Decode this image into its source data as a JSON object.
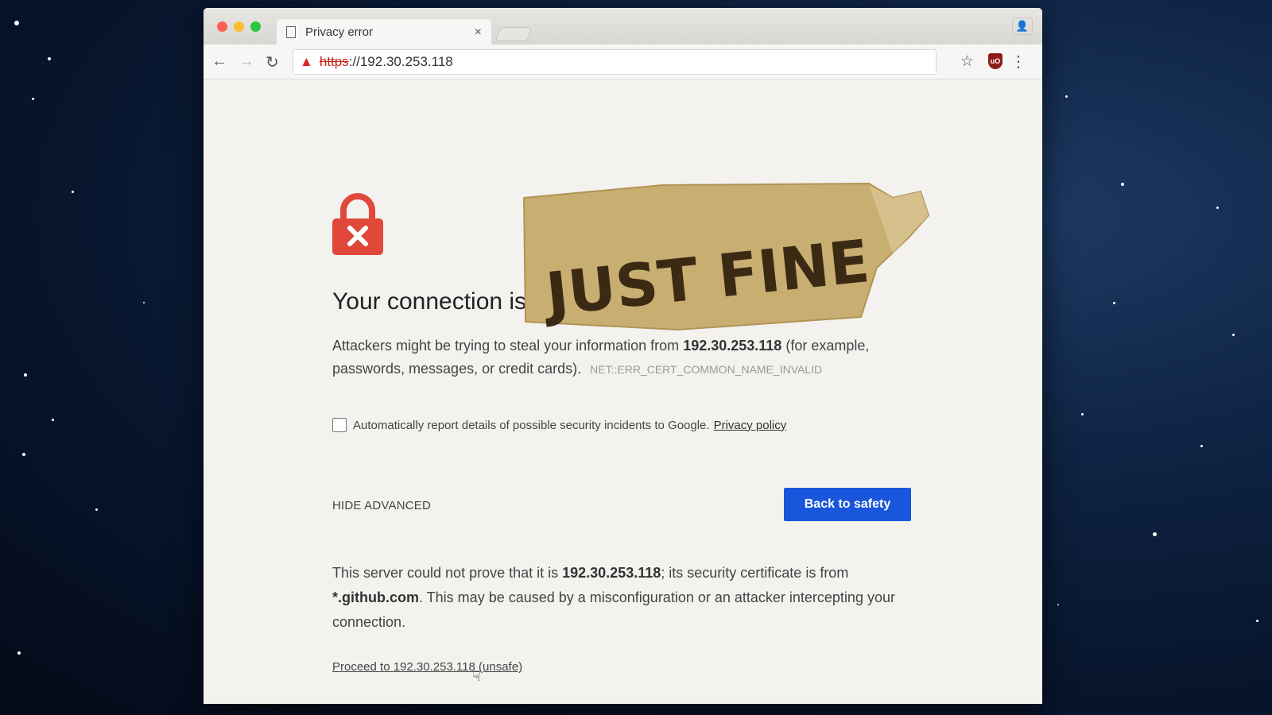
{
  "browser": {
    "tab_title": "Privacy error",
    "tab_close": "×",
    "url_scheme": "https",
    "url_rest": "://192.30.253.118",
    "ublock_label": "uO"
  },
  "page": {
    "heading": "Your connection is",
    "tape_text": "JUST FINE",
    "desc_1": "Attackers might be trying to steal your information from ",
    "desc_host": "192.30.253.118",
    "desc_2": " (for example, passwords, messages, or credit cards).",
    "error_code": "NET::ERR_CERT_COMMON_NAME_INVALID",
    "report_text": "Automatically report details of possible security incidents to Google.",
    "privacy_link": "Privacy policy",
    "hide_advanced": "HIDE ADVANCED",
    "back_to_safety": "Back to safety",
    "detail_1": "This server could not prove that it is ",
    "detail_host": "192.30.253.118",
    "detail_2": "; its security certificate is from ",
    "detail_cert": "*.github.com",
    "detail_3": ". This may be caused by a misconfiguration or an attacker intercepting your connection.",
    "proceed_link": "Proceed to 192.30.253.118 (unsafe)"
  },
  "colors": {
    "accent_button": "#1a56db",
    "lock_red": "#e0483a",
    "tape": "#c9ae71"
  }
}
